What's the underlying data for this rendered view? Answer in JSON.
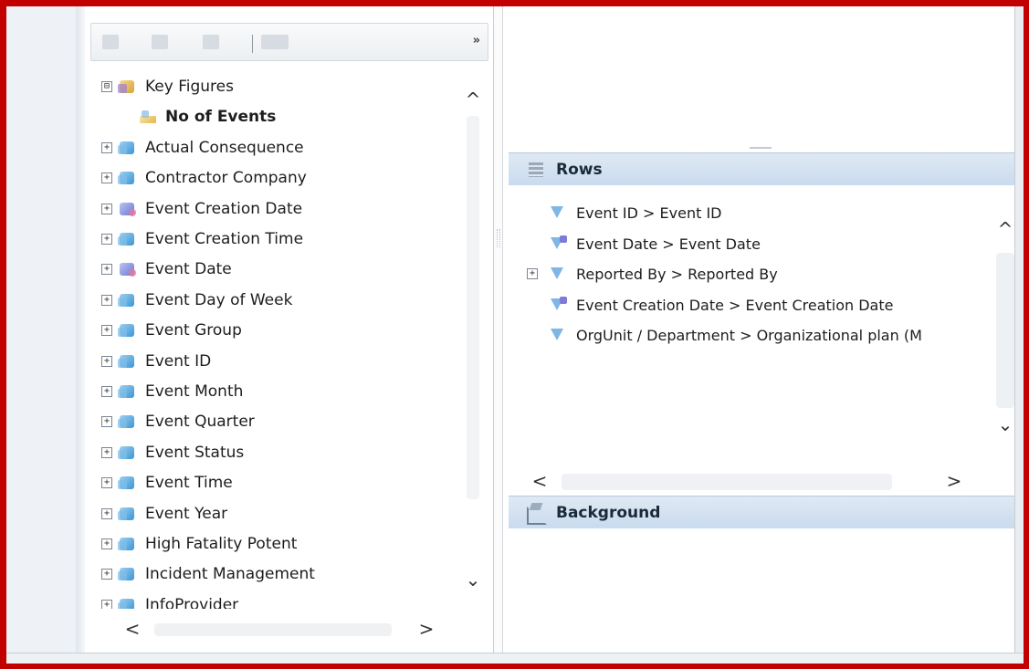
{
  "toolbar": {
    "more_label": "»"
  },
  "tree": {
    "items": [
      {
        "label": "Key Figures",
        "expander": "⊟",
        "icon": "key-figures-icon",
        "kind": "kf"
      },
      {
        "label": "No of Events",
        "expander": "",
        "icon": "measure-icon",
        "kind": "measure",
        "bold": true
      },
      {
        "label": "Actual Consequence",
        "expander": "+",
        "icon": "dimension-icon",
        "kind": "dim"
      },
      {
        "label": "Contractor Company",
        "expander": "+",
        "icon": "dimension-icon",
        "kind": "dim"
      },
      {
        "label": "Event Creation Date",
        "expander": "+",
        "icon": "date-dimension-icon",
        "kind": "date"
      },
      {
        "label": "Event Creation Time",
        "expander": "+",
        "icon": "dimension-icon",
        "kind": "dim"
      },
      {
        "label": "Event Date",
        "expander": "+",
        "icon": "date-dimension-icon",
        "kind": "date"
      },
      {
        "label": "Event Day of Week",
        "expander": "+",
        "icon": "dimension-icon",
        "kind": "dim"
      },
      {
        "label": "Event Group",
        "expander": "+",
        "icon": "dimension-icon",
        "kind": "dim"
      },
      {
        "label": "Event ID",
        "expander": "+",
        "icon": "dimension-icon",
        "kind": "dim"
      },
      {
        "label": "Event Month",
        "expander": "+",
        "icon": "dimension-icon",
        "kind": "dim"
      },
      {
        "label": "Event Quarter",
        "expander": "+",
        "icon": "dimension-icon",
        "kind": "dim"
      },
      {
        "label": "Event Status",
        "expander": "+",
        "icon": "dimension-icon",
        "kind": "dim"
      },
      {
        "label": "Event Time",
        "expander": "+",
        "icon": "dimension-icon",
        "kind": "dim"
      },
      {
        "label": "Event Year",
        "expander": "+",
        "icon": "dimension-icon",
        "kind": "dim"
      },
      {
        "label": "High Fatality Potent",
        "expander": "+",
        "icon": "dimension-icon",
        "kind": "dim"
      },
      {
        "label": "Incident Management",
        "expander": "+",
        "icon": "dimension-icon",
        "kind": "dim"
      },
      {
        "label": "InfoProvider",
        "expander": "+",
        "icon": "dimension-icon",
        "kind": "dim"
      }
    ]
  },
  "rows_section": {
    "title": "Rows",
    "items": [
      {
        "label": "Event ID > Event ID",
        "expander": "",
        "dual": false
      },
      {
        "label": "Event Date > Event Date",
        "expander": "",
        "dual": true
      },
      {
        "label": "Reported By > Reported By",
        "expander": "+",
        "dual": false
      },
      {
        "label": "Event Creation Date > Event Creation Date",
        "expander": "",
        "dual": true
      },
      {
        "label": "OrgUnit / Department > Organizational plan (M",
        "expander": "",
        "dual": false
      }
    ]
  },
  "background_section": {
    "title": "Background"
  },
  "scroll": {
    "up": "^",
    "down": "⌄",
    "left": "<",
    "right": ">"
  }
}
